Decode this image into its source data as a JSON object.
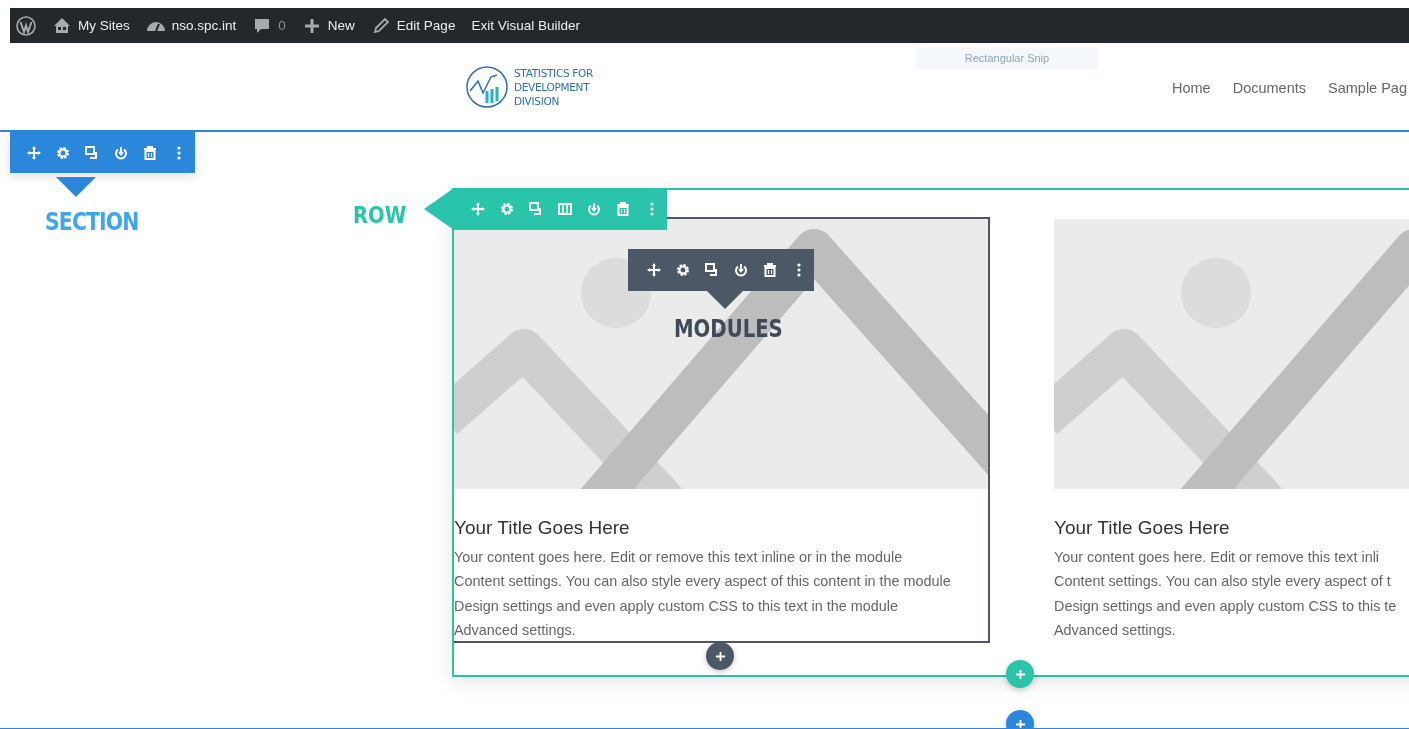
{
  "admin_bar": {
    "items": [
      {
        "kind": "wordpress"
      },
      {
        "kind": "sites",
        "label": "My Sites"
      },
      {
        "kind": "dashboard",
        "label": "nso.spc.int"
      },
      {
        "kind": "comments",
        "label": "0"
      },
      {
        "kind": "new",
        "label": "New"
      },
      {
        "kind": "edit",
        "label": "Edit Page"
      },
      {
        "kind": "text",
        "label": "Exit Visual Builder"
      }
    ]
  },
  "header": {
    "logo_lines": [
      "STATISTICS FOR",
      "DEVELOPMENT",
      "DIVISION"
    ],
    "snip_tooltip": "Rectangular Snip",
    "nav": [
      "Home",
      "Documents",
      "Sample Pag"
    ]
  },
  "builder": {
    "section_label": "SECTION",
    "row_label": "ROW",
    "modules_label": "MODULES",
    "modules": [
      {
        "title": "Your Title Goes Here",
        "lines": [
          "Your content goes here. Edit or remove this text inline or in the module",
          "Content settings. You can also style every aspect of this content in the module",
          "Design settings and even apply custom CSS to this text in the module",
          "Advanced settings."
        ],
        "hovered": true
      },
      {
        "title": "Your Title Goes Here",
        "lines": [
          "Your content goes here. Edit or remove this text inli",
          "Content settings. You can also style every aspect of t",
          "Design settings and even apply custom CSS to this te",
          "Advanced settings."
        ],
        "hovered": false
      }
    ]
  }
}
